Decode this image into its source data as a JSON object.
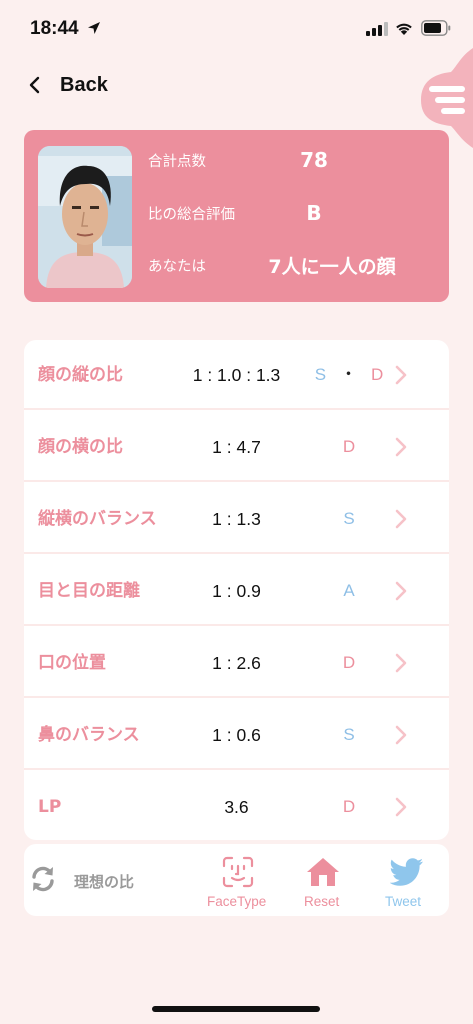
{
  "status_bar": {
    "time": "18:44"
  },
  "nav": {
    "back_label": "Back"
  },
  "profile": {
    "stats": [
      {
        "label": "合計点数",
        "value": "78"
      },
      {
        "label": "比の総合評価",
        "value": "B"
      },
      {
        "label": "あなたは",
        "value": "7人に一人の顔"
      }
    ]
  },
  "ratios": [
    {
      "label": "顔の縦の比",
      "value": "1 : 1.0 : 1.3",
      "grades": [
        "S",
        "D"
      ],
      "separator": "・"
    },
    {
      "label": "顔の横の比",
      "value": "1 : 4.7",
      "grades": [
        "D"
      ]
    },
    {
      "label": "縦横のバランス",
      "value": "1 : 1.3",
      "grades": [
        "S"
      ]
    },
    {
      "label": "目と目の距離",
      "value": "1 : 0.9",
      "grades": [
        "A"
      ]
    },
    {
      "label": "口の位置",
      "value": "1 : 2.6",
      "grades": [
        "D"
      ]
    },
    {
      "label": "鼻のバランス",
      "value": "1 : 0.6",
      "grades": [
        "S"
      ]
    },
    {
      "label": "LP",
      "value": "3.6",
      "grades": [
        "D"
      ]
    }
  ],
  "toolbar": {
    "ideal_label": "理想の比",
    "facetype_label": "FaceType",
    "reset_label": "Reset",
    "tweet_label": "Tweet"
  },
  "colors": {
    "accent_pink": "#ec8f9d",
    "grade_blue": "#8fbfe6",
    "background": "#fcf0ef",
    "icon_gray": "#9a9a9a"
  }
}
